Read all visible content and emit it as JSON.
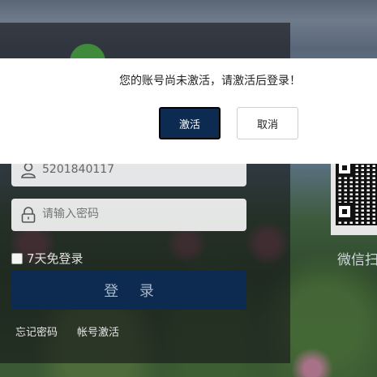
{
  "modal": {
    "message": "您的账号尚未激活，请激活后登录！",
    "activate_label": "激活",
    "cancel_label": "取消"
  },
  "login": {
    "username_value": "5201840117",
    "password_placeholder": "请输入密码",
    "remember_label": "7天免登录",
    "submit_label": "登 录",
    "forgot_link": "忘记密码",
    "activate_link": "帐号激活",
    "username_icon": "user-icon",
    "password_icon": "lock-icon"
  },
  "qr_panel": {
    "hint": "微信扫"
  },
  "colors": {
    "primary": "#0d2b50",
    "panel_overlay": "rgba(22,22,26,0.62)"
  }
}
